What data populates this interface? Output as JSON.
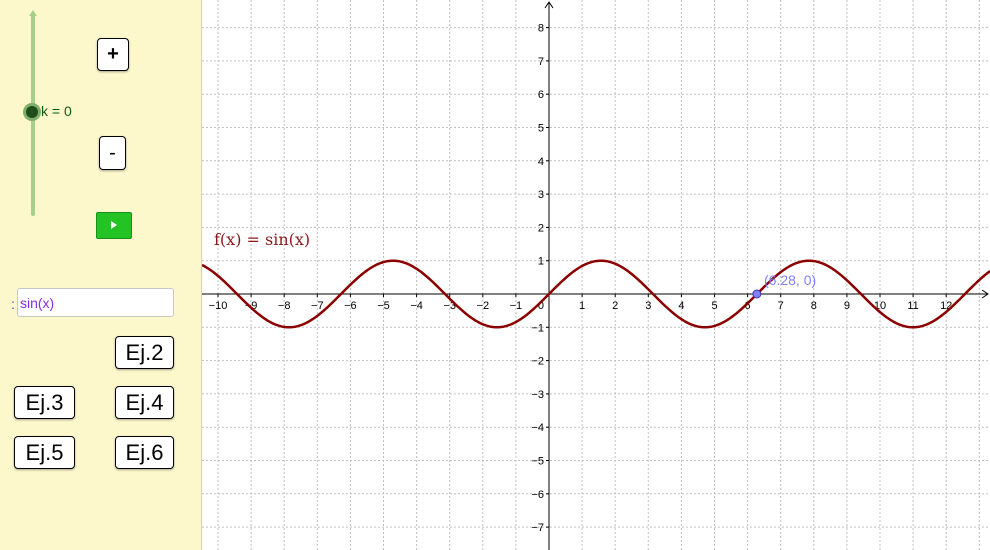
{
  "slider": {
    "label": "k = 0",
    "value": 0,
    "track_color": "#a6cf8e",
    "knob_color": "#1f4d1a"
  },
  "controls": {
    "plus_label": "+",
    "minus_label": "-",
    "play_icon": "play-icon",
    "play_color": "#22c322"
  },
  "input": {
    "prefix": ":",
    "value": "sin(x)",
    "text_color": "#8a2be2"
  },
  "examples": {
    "ej2": "Ej.2",
    "ej3": "Ej.3",
    "ej4": "Ej.4",
    "ej5": "Ej.5",
    "ej6": "Ej.6"
  },
  "graph": {
    "function_label": "f(x) = sin(x)",
    "curve_color": "#8b0000",
    "x_range": [
      -10.4,
      13.1
    ],
    "y_range": [
      -7.8,
      8.6
    ],
    "x_ticks": [
      "−10",
      "−9",
      "−8",
      "−7",
      "−6",
      "−5",
      "−4",
      "−3",
      "−2",
      "−1",
      "1",
      "2",
      "3",
      "4",
      "5",
      "6",
      "7",
      "8",
      "9",
      "10",
      "11",
      "12"
    ],
    "y_ticks": [
      "8",
      "7",
      "6",
      "5",
      "4",
      "3",
      "2",
      "1",
      "−1",
      "−2",
      "−3",
      "−4",
      "−5",
      "−6",
      "−7"
    ],
    "origin_label": "0",
    "point": {
      "label": "(6.28, 0)",
      "x": 6.28,
      "y": 0,
      "color": "#8080ff"
    }
  }
}
